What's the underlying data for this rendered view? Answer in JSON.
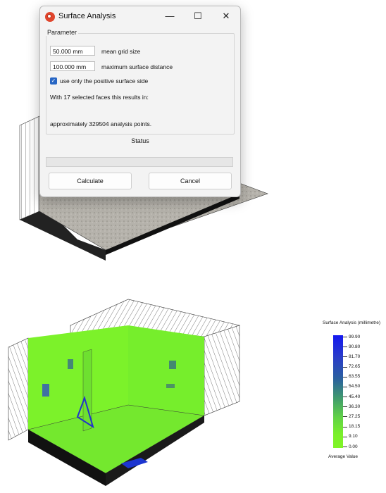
{
  "dialog": {
    "title": "Surface Analysis",
    "minimize_symbol": "—",
    "maximize_symbol": "☐",
    "close_symbol": "✕",
    "group_label": "Parameter",
    "mean_grid_size": {
      "value": "50.000 mm",
      "label": "mean grid size"
    },
    "max_surface_distance": {
      "value": "100.000 mm",
      "label": "maximum surface distance"
    },
    "positive_side": {
      "checked": true,
      "label": "use only the positive surface side"
    },
    "info_line1": "With 17 selected faces this results in:",
    "info_line2": "approximately 329504 analysis points.",
    "status_label": "Status",
    "progress": 0,
    "calculate_label": "Calculate",
    "cancel_label": "Cancel",
    "icon_color": "#e0462d"
  },
  "legend": {
    "title": "Surface Analysis (millimetre)",
    "values": [
      "99.90",
      "90.80",
      "81.70",
      "72.65",
      "63.55",
      "54.50",
      "45.40",
      "36.30",
      "27.25",
      "18.15",
      "9.10",
      "0.00"
    ],
    "footer": "Average Value",
    "color_high": "#1418f0",
    "color_low": "#80f526"
  }
}
